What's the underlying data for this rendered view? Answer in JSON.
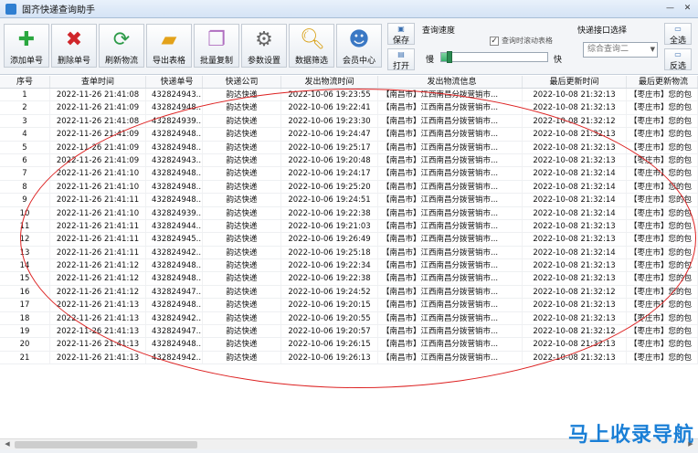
{
  "window": {
    "title": "固齐快递查询助手"
  },
  "toolbar": {
    "add": "添加单号",
    "delete": "删除单号",
    "refresh": "刷新物流",
    "export": "导出表格",
    "copy": "批量复制",
    "settings": "参数设置",
    "filter": "数据筛选",
    "member": "会员中心",
    "save": "保存",
    "open": "打开",
    "select_all": "全选",
    "invert": "反选"
  },
  "speed": {
    "title": "查询速度",
    "auto_scroll": "查询时滚动表格",
    "slow": "慢",
    "fast": "快",
    "level": 0.08
  },
  "api": {
    "title": "快递接口选择",
    "selected": "综合查询二"
  },
  "table": {
    "headers": [
      "序号",
      "查单时间",
      "快递单号",
      "快递公司",
      "发出物流时间",
      "发出物流信息",
      "最后更新时间",
      "最后更新物流"
    ],
    "rows": [
      [
        "1",
        "2022-11-26  21:41:08",
        "432824943...",
        "韵达快递",
        "2022-10-06  19:23:55",
        "【南昌市】江西南昌分拨营销市...",
        "2022-10-08  21:32:13",
        "【枣庄市】您的包"
      ],
      [
        "2",
        "2022-11-26  21:41:09",
        "432824948...",
        "韵达快递",
        "2022-10-06  19:22:41",
        "【南昌市】江西南昌分拨营销市...",
        "2022-10-08  21:32:13",
        "【枣庄市】您的包"
      ],
      [
        "3",
        "2022-11-26  21:41:08",
        "432824939...",
        "韵达快递",
        "2022-10-06  19:23:30",
        "【南昌市】江西南昌分拨营销市...",
        "2022-10-08  21:32:12",
        "【枣庄市】您的包"
      ],
      [
        "4",
        "2022-11-26  21:41:09",
        "432824948...",
        "韵达快递",
        "2022-10-06  19:24:47",
        "【南昌市】江西南昌分拨营销市...",
        "2022-10-08  21:32:13",
        "【枣庄市】您的包"
      ],
      [
        "5",
        "2022-11-26  21:41:09",
        "432824948...",
        "韵达快递",
        "2022-10-06  19:25:17",
        "【南昌市】江西南昌分拨营销市...",
        "2022-10-08  21:32:13",
        "【枣庄市】您的包"
      ],
      [
        "6",
        "2022-11-26  21:41:09",
        "432824943...",
        "韵达快递",
        "2022-10-06  19:20:48",
        "【南昌市】江西南昌分拨营销市...",
        "2022-10-08  21:32:13",
        "【枣庄市】您的包"
      ],
      [
        "7",
        "2022-11-26  21:41:10",
        "432824948...",
        "韵达快递",
        "2022-10-06  19:24:17",
        "【南昌市】江西南昌分拨营销市...",
        "2022-10-08  21:32:14",
        "【枣庄市】您的包"
      ],
      [
        "8",
        "2022-11-26  21:41:10",
        "432824948...",
        "韵达快递",
        "2022-10-06  19:25:20",
        "【南昌市】江西南昌分拨营销市...",
        "2022-10-08  21:32:14",
        "【枣庄市】您的包"
      ],
      [
        "9",
        "2022-11-26  21:41:11",
        "432824948...",
        "韵达快递",
        "2022-10-06  19:24:51",
        "【南昌市】江西南昌分拨营销市...",
        "2022-10-08  21:32:14",
        "【枣庄市】您的包"
      ],
      [
        "10",
        "2022-11-26  21:41:10",
        "432824939...",
        "韵达快递",
        "2022-10-06  19:22:38",
        "【南昌市】江西南昌分拨营销市...",
        "2022-10-08  21:32:14",
        "【枣庄市】您的包"
      ],
      [
        "11",
        "2022-11-26  21:41:11",
        "432824944...",
        "韵达快递",
        "2022-10-06  19:21:03",
        "【南昌市】江西南昌分拨营销市...",
        "2022-10-08  21:32:13",
        "【枣庄市】您的包"
      ],
      [
        "12",
        "2022-11-26  21:41:11",
        "432824945...",
        "韵达快递",
        "2022-10-06  19:26:49",
        "【南昌市】江西南昌分拨营销市...",
        "2022-10-08  21:32:13",
        "【枣庄市】您的包"
      ],
      [
        "13",
        "2022-11-26  21:41:11",
        "432824942...",
        "韵达快递",
        "2022-10-06  19:25:18",
        "【南昌市】江西南昌分拨营销市...",
        "2022-10-08  21:32:14",
        "【枣庄市】您的包"
      ],
      [
        "14",
        "2022-11-26  21:41:12",
        "432824948...",
        "韵达快递",
        "2022-10-06  19:22:34",
        "【南昌市】江西南昌分拨营销市...",
        "2022-10-08  21:32:13",
        "【枣庄市】您的包"
      ],
      [
        "15",
        "2022-11-26  21:41:12",
        "432824948...",
        "韵达快递",
        "2022-10-06  19:22:38",
        "【南昌市】江西南昌分拨营销市...",
        "2022-10-08  21:32:13",
        "【枣庄市】您的包"
      ],
      [
        "16",
        "2022-11-26  21:41:12",
        "432824947...",
        "韵达快递",
        "2022-10-06  19:24:52",
        "【南昌市】江西南昌分拨营销市...",
        "2022-10-08  21:32:12",
        "【枣庄市】您的包"
      ],
      [
        "17",
        "2022-11-26  21:41:13",
        "432824948...",
        "韵达快递",
        "2022-10-06  19:20:15",
        "【南昌市】江西南昌分拨营销市...",
        "2022-10-08  21:32:13",
        "【枣庄市】您的包"
      ],
      [
        "18",
        "2022-11-26  21:41:13",
        "432824942...",
        "韵达快递",
        "2022-10-06  19:20:55",
        "【南昌市】江西南昌分拨营销市...",
        "2022-10-08  21:32:13",
        "【枣庄市】您的包"
      ],
      [
        "19",
        "2022-11-26  21:41:13",
        "432824947...",
        "韵达快递",
        "2022-10-06  19:20:57",
        "【南昌市】江西南昌分拨营销市...",
        "2022-10-08  21:32:12",
        "【枣庄市】您的包"
      ],
      [
        "20",
        "2022-11-26  21:41:13",
        "432824948...",
        "韵达快递",
        "2022-10-06  19:26:15",
        "【南昌市】江西南昌分拨营销市...",
        "2022-10-08  21:32:13",
        "【枣庄市】您的包"
      ],
      [
        "21",
        "2022-11-26  21:41:13",
        "432824942...",
        "韵达快递",
        "2022-10-06  19:26:13",
        "【南昌市】江西南昌分拨营销市...",
        "2022-10-08  21:32:13",
        "【枣庄市】您的包"
      ]
    ]
  },
  "watermark": "马上收录导航",
  "icons": {
    "add": "plus-icon",
    "delete": "x-icon",
    "refresh": "refresh-icon",
    "export": "folder-icon",
    "copy": "copy-icon",
    "settings": "gear-icon",
    "filter": "magnifier-icon",
    "member": "users-icon"
  },
  "colors": {
    "add": "#2aa73f",
    "delete": "#d0262b",
    "refresh": "#2c9a48",
    "oval": "#dd2222",
    "watermark": "#1a7fd6"
  }
}
